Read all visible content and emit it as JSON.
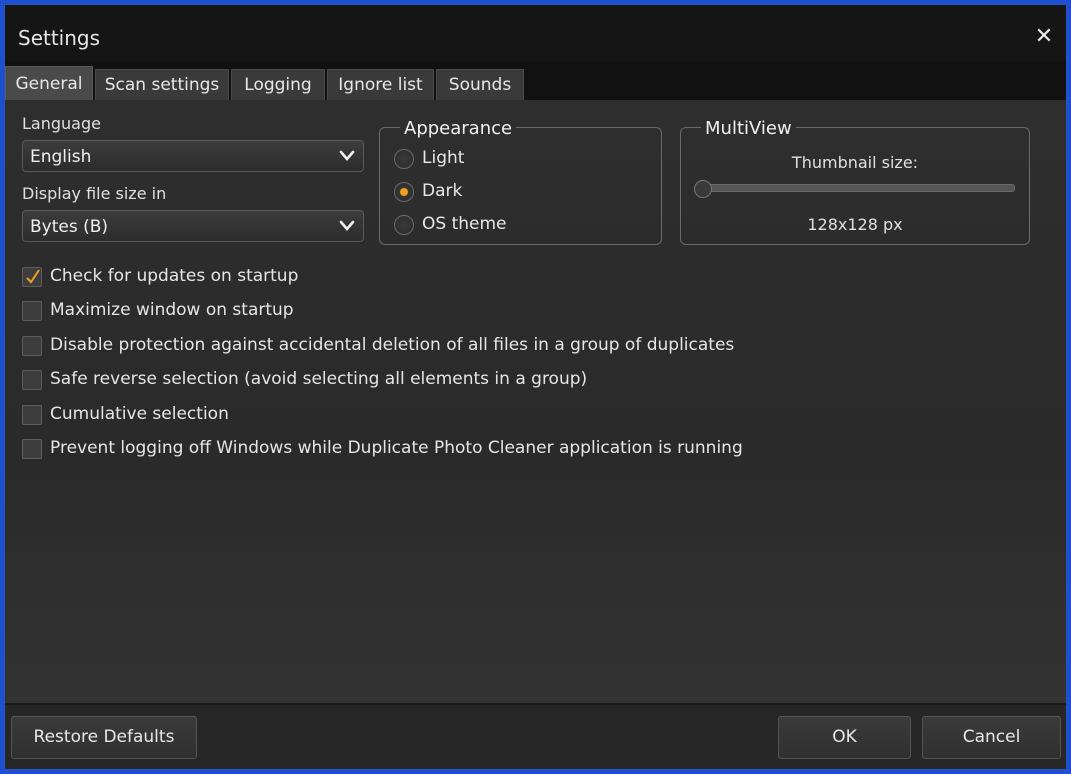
{
  "window": {
    "title": "Settings"
  },
  "tabs": [
    {
      "label": "General",
      "active": true
    },
    {
      "label": "Scan settings",
      "active": false
    },
    {
      "label": "Logging",
      "active": false
    },
    {
      "label": "Ignore list",
      "active": false
    },
    {
      "label": "Sounds",
      "active": false
    }
  ],
  "language": {
    "label": "Language",
    "value": "English"
  },
  "file_size": {
    "label": "Display file size in",
    "value": "Bytes (B)"
  },
  "appearance": {
    "title": "Appearance",
    "options": [
      {
        "label": "Light",
        "selected": false
      },
      {
        "label": "Dark",
        "selected": true
      },
      {
        "label": "OS theme",
        "selected": false
      }
    ],
    "accent_color": "#f0a020"
  },
  "multiview": {
    "title": "MultiView",
    "thumbnail_label": "Thumbnail size:",
    "thumbnail_value": "128x128 px",
    "slider_level": 0
  },
  "checkboxes": [
    {
      "label": "Check for updates on startup",
      "checked": true
    },
    {
      "label": "Maximize window on startup",
      "checked": false
    },
    {
      "label": "Disable protection against accidental deletion of all files in a group of duplicates",
      "checked": false
    },
    {
      "label": "Safe reverse selection (avoid selecting all elements in a group)",
      "checked": false
    },
    {
      "label": "Cumulative selection",
      "checked": false
    },
    {
      "label": "Prevent logging off Windows while Duplicate Photo Cleaner application is running",
      "checked": false
    }
  ],
  "footer": {
    "restore_label": "Restore Defaults",
    "ok_label": "OK",
    "cancel_label": "Cancel"
  }
}
